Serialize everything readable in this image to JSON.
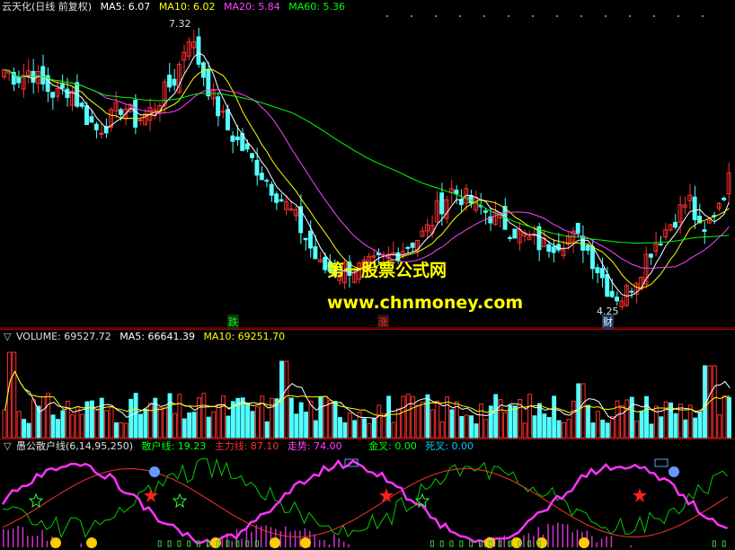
{
  "price_header": {
    "title": "云天化(日线 前复权)",
    "ma5": "MA5: 6.07",
    "ma10": "MA10: 6.02",
    "ma20": "MA20: 5.84",
    "ma60": "MA60: 5.36",
    "colors": {
      "title": "#e0e0e0",
      "ma5": "#ffffff",
      "ma10": "#ffff00",
      "ma20": "#ff44ff",
      "ma60": "#00ff00"
    }
  },
  "price_marks": {
    "high": "7.32",
    "low": "4.25",
    "die": "跌",
    "zhang": "涨",
    "cai": "财"
  },
  "watermark": {
    "line1": "第一股票公式网",
    "line2": "www.chnmoney.com"
  },
  "volume_header": {
    "volume": "VOLUME: 69527.72",
    "ma5": "MA5: 66641.39",
    "ma10": "MA10: 69251.70"
  },
  "indicator_header": {
    "name": "愚公散户线(6,14,95,250)",
    "sanhu": "散户线: 19.23",
    "zhuli": "主力线: 87.10",
    "zoushi": "走势: 74.00",
    "jincha": "金叉: 0.00",
    "sicha": "死叉: 0.00"
  },
  "chart_data": {
    "type": "line",
    "title": "云天化(日线 前复权)",
    "price_annotations": {
      "high": 7.32,
      "low": 4.25
    },
    "price_series_approx": [
      6.9,
      6.8,
      6.9,
      6.7,
      6.6,
      6.7,
      6.4,
      6.2,
      6.3,
      6.5,
      6.3,
      6.4,
      6.6,
      6.8,
      7.32,
      6.9,
      6.5,
      6.2,
      6.0,
      5.8,
      5.6,
      5.4,
      5.2,
      4.9,
      4.6,
      4.55,
      4.6,
      4.58,
      4.62,
      4.7,
      4.8,
      4.9,
      5.0,
      5.3,
      5.5,
      5.4,
      5.3,
      5.2,
      5.1,
      5.0,
      4.9,
      4.85,
      4.9,
      4.95,
      4.88,
      4.6,
      4.3,
      4.25,
      4.5,
      4.8,
      5.0,
      5.2,
      5.4,
      4.9,
      5.3,
      5.6
    ]
  }
}
